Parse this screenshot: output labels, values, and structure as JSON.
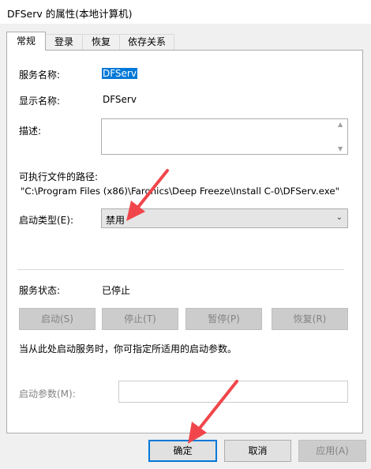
{
  "window": {
    "title": "DFServ 的属性(本地计算机)"
  },
  "tabs": [
    {
      "label": "常规",
      "active": true
    },
    {
      "label": "登录",
      "active": false
    },
    {
      "label": "恢复",
      "active": false
    },
    {
      "label": "依存关系",
      "active": false
    }
  ],
  "general": {
    "service_name_label": "服务名称:",
    "service_name_value": "DFServ",
    "display_name_label": "显示名称:",
    "display_name_value": "DFServ",
    "description_label": "描述:",
    "description_value": "",
    "exe_path_label": "可执行文件的路径:",
    "exe_path_value": "\"C:\\Program Files (x86)\\Faronics\\Deep Freeze\\Install C-0\\DFServ.exe\"",
    "startup_type_label": "启动类型(E):",
    "startup_type_value": "禁用",
    "service_status_label": "服务状态:",
    "service_status_value": "已停止",
    "start_button": "启动(S)",
    "stop_button": "停止(T)",
    "pause_button": "暂停(P)",
    "resume_button": "恢复(R)",
    "hint_text": "当从此处启动服务时，你可指定所适用的启动参数。",
    "start_params_label": "启动参数(M):",
    "start_params_value": ""
  },
  "footer": {
    "ok_button": "确定",
    "cancel_button": "取消",
    "apply_button": "应用(A)"
  },
  "colors": {
    "accent": "#0078d7",
    "annotation_arrow": "#f0464b"
  }
}
